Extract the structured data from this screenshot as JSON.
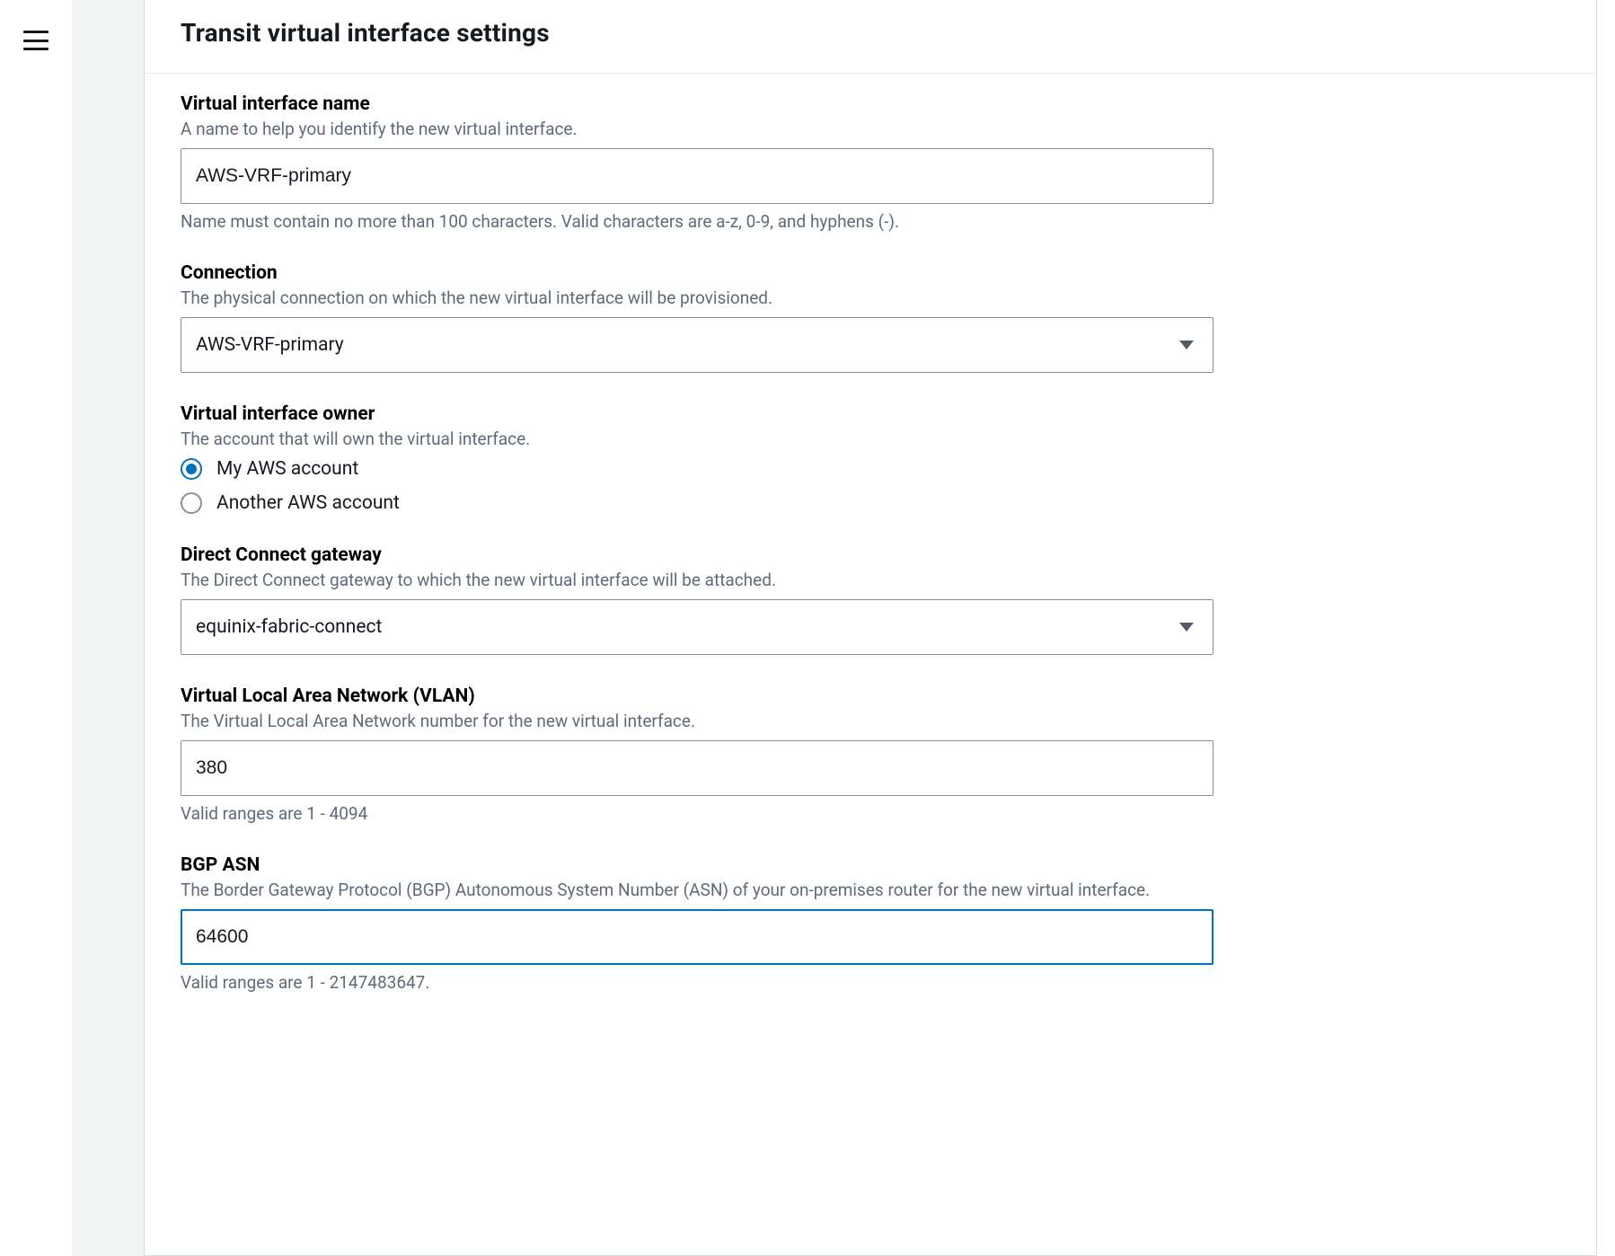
{
  "panel": {
    "title": "Transit virtual interface settings"
  },
  "fields": {
    "vif_name": {
      "label": "Virtual interface name",
      "desc": "A name to help you identify the new virtual interface.",
      "value": "AWS-VRF-primary",
      "helper": "Name must contain no more than 100 characters. Valid characters are a-z, 0-9, and hyphens (-)."
    },
    "connection": {
      "label": "Connection",
      "desc": "The physical connection on which the new virtual interface will be provisioned.",
      "selected": "AWS-VRF-primary"
    },
    "owner": {
      "label": "Virtual interface owner",
      "desc": "The account that will own the virtual interface.",
      "options": {
        "my": "My AWS account",
        "other": "Another AWS account"
      }
    },
    "gateway": {
      "label": "Direct Connect gateway",
      "desc": "The Direct Connect gateway to which the new virtual interface will be attached.",
      "selected": "equinix-fabric-connect"
    },
    "vlan": {
      "label": "Virtual Local Area Network (VLAN)",
      "desc": "The Virtual Local Area Network number for the new virtual interface.",
      "value": "380",
      "helper": "Valid ranges are 1 - 4094"
    },
    "bgp_asn": {
      "label": "BGP ASN",
      "desc": "The Border Gateway Protocol (BGP) Autonomous System Number (ASN) of your on-premises router for the new virtual interface.",
      "value": "64600",
      "helper": "Valid ranges are 1 - 2147483647."
    }
  }
}
